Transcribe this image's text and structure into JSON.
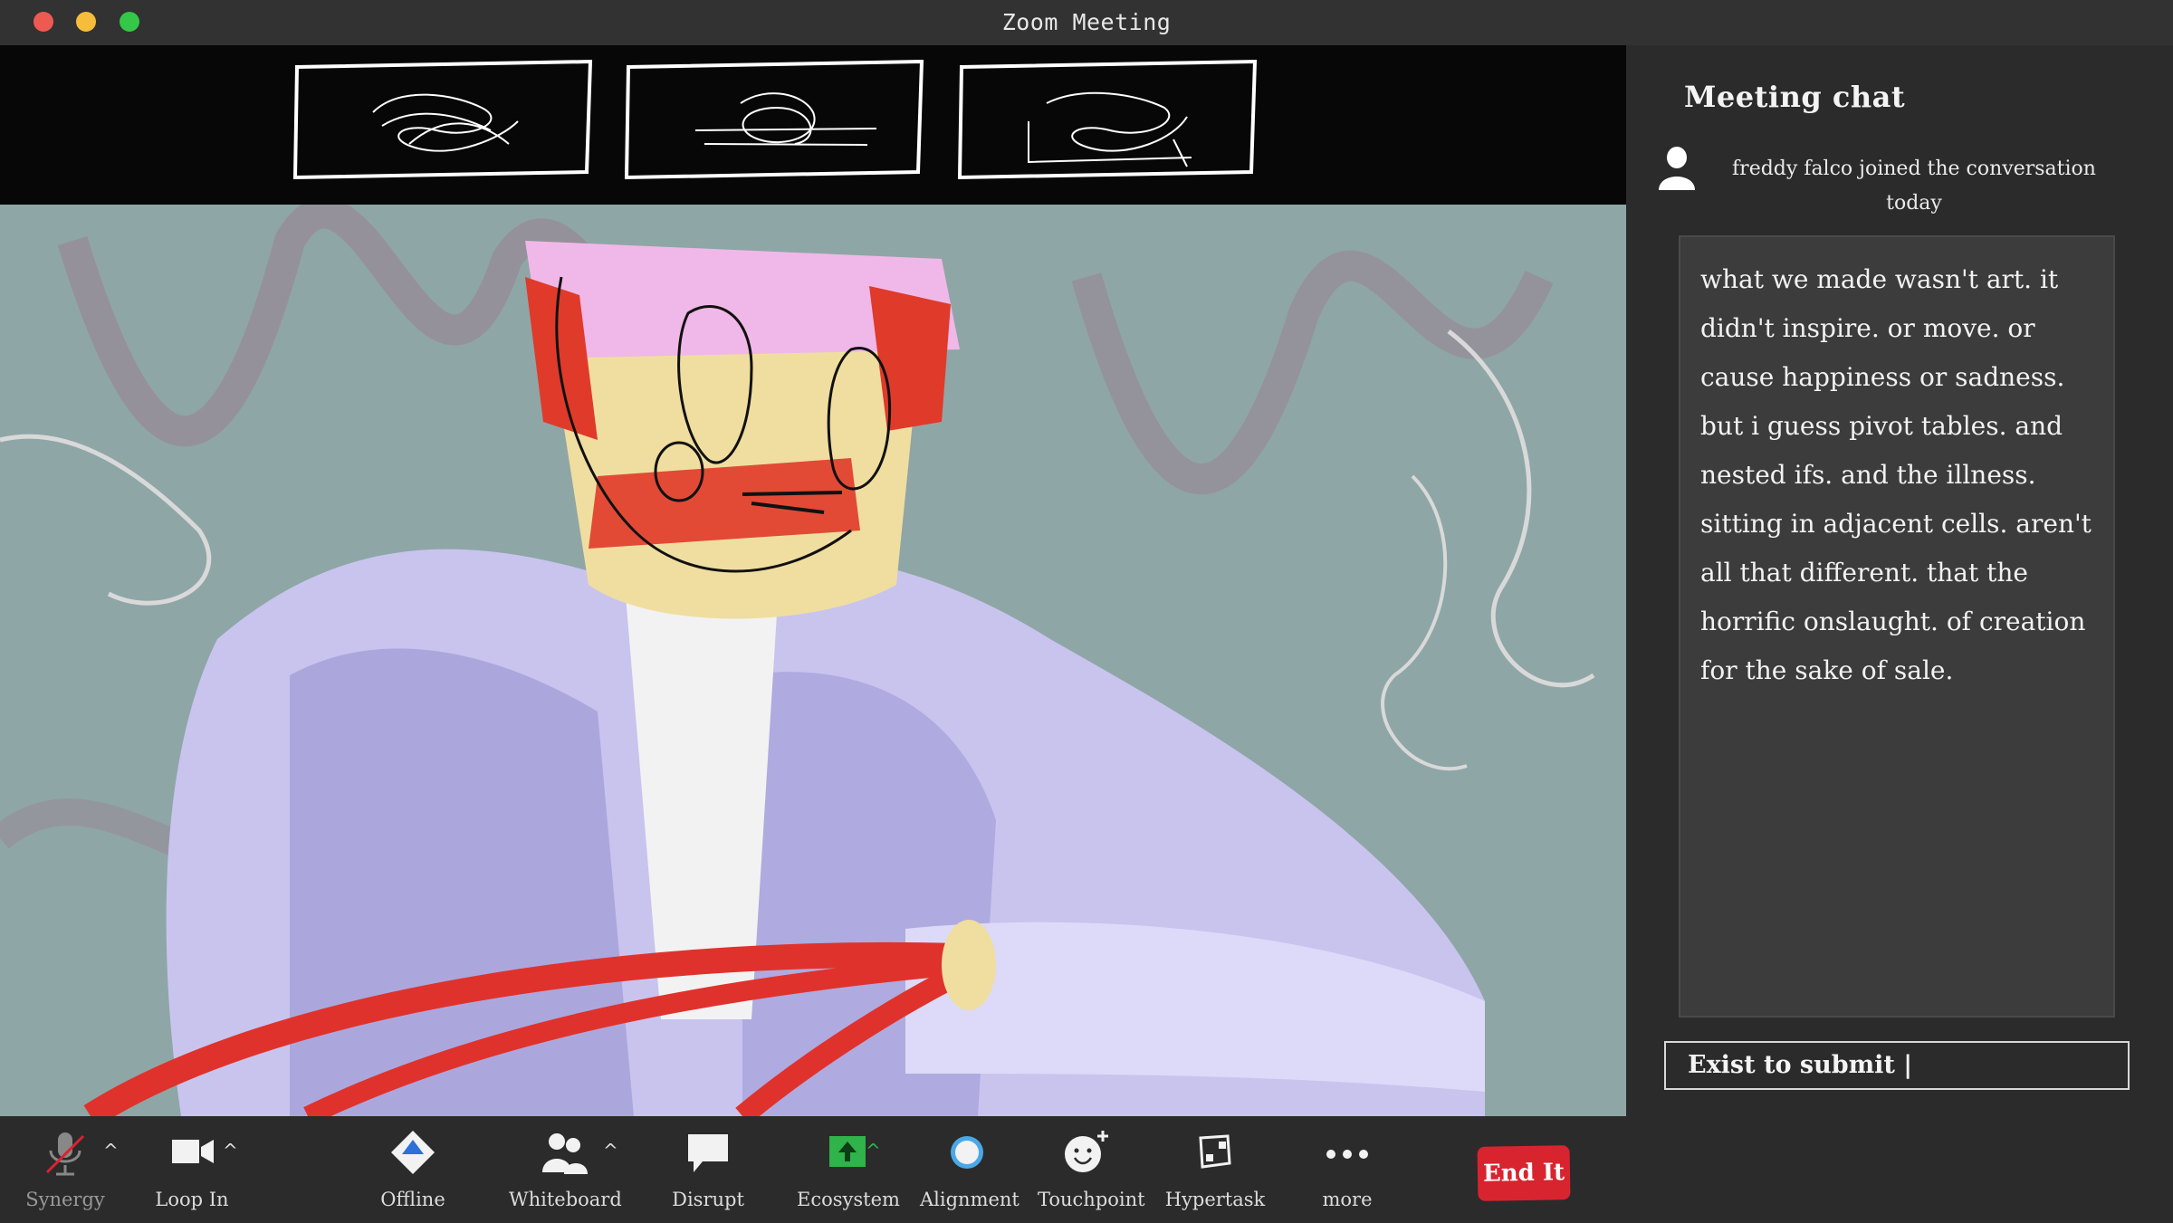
{
  "window": {
    "title": "Zoom Meeting"
  },
  "chat": {
    "title": "Meeting chat",
    "join_notice": "freddy falco  joined the conversation today",
    "message": "what we made wasn't art. it didn't inspire. or move. or cause happiness or sadness. but i guess pivot tables. and nested ifs. and the illness. sitting in adjacent cells. aren't all that different. that the horrific onslaught. of creation for the sake of sale.",
    "input_value": "Exist to submit |"
  },
  "toolbar": {
    "synergy": "Synergy",
    "loop_in": "Loop In",
    "offline": "Offline",
    "whiteboard": "Whiteboard",
    "disrupt": "Disrupt",
    "ecosystem": "Ecosystem",
    "alignment": "Alignment",
    "touchpoint": "Touchpoint",
    "hypertask": "Hypertask",
    "more": "more",
    "end": "End It"
  },
  "colors": {
    "end_button": "#d8242f",
    "ecosystem_icon": "#2fb34a",
    "alignment_icon": "#4aa8e8"
  }
}
